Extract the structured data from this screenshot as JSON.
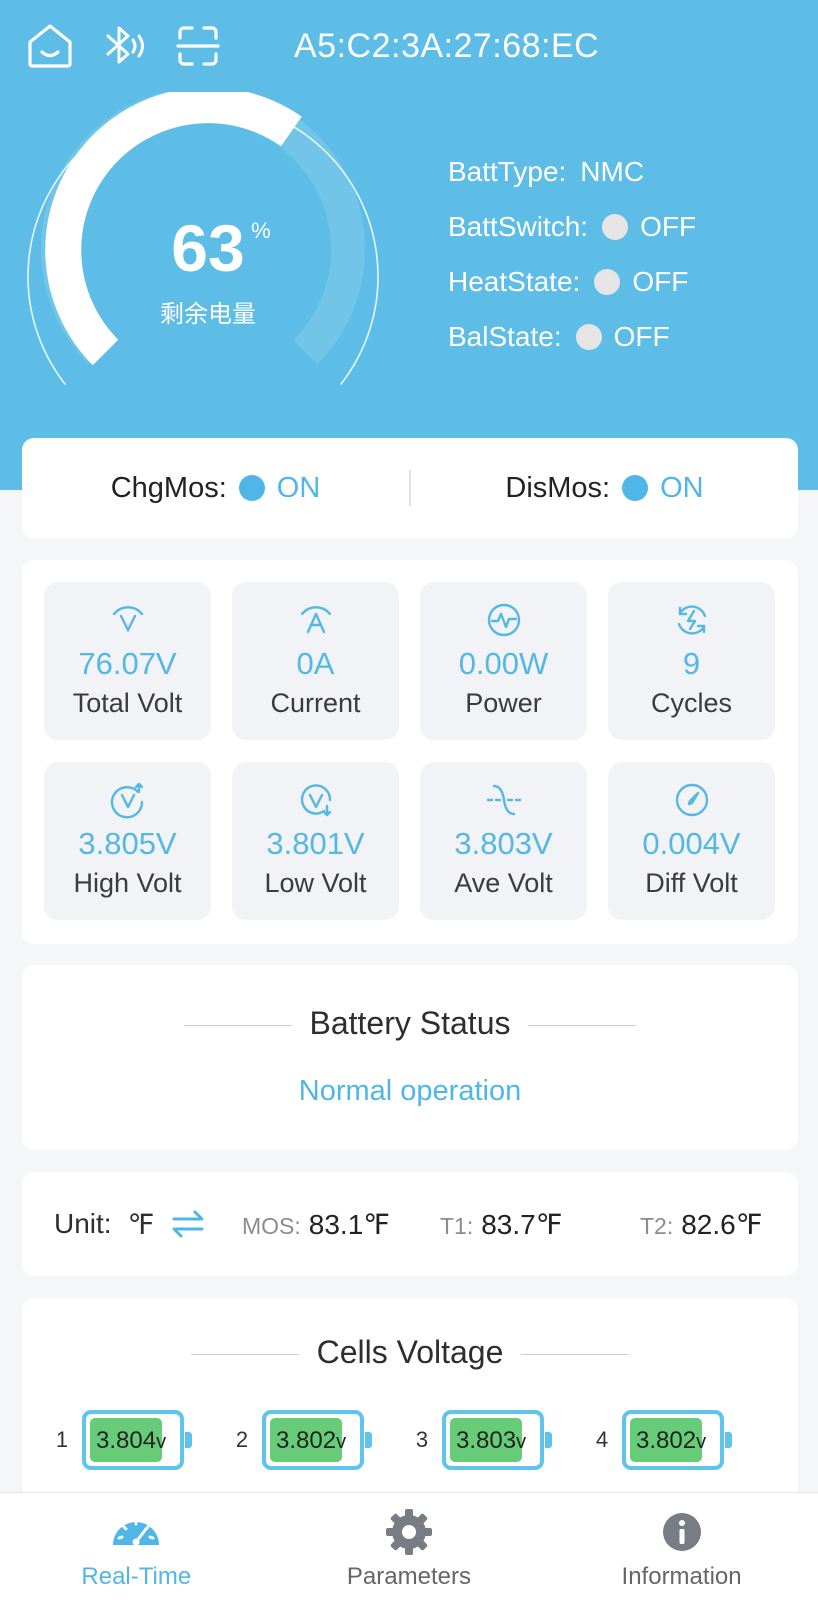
{
  "header": {
    "icons": [
      "home-icon",
      "bluetooth-icon",
      "scan-icon"
    ],
    "device_mac": "A5:C2:3A:27:68:EC"
  },
  "gauge": {
    "soc_value": "63",
    "soc_unit": "%",
    "soc_fraction": 0.63,
    "label": "剩余电量"
  },
  "status": {
    "batt_type_key": "BattType:",
    "batt_type_val": "NMC",
    "batt_switch_key": "BattSwitch:",
    "batt_switch_val": "OFF",
    "heat_state_key": "HeatState:",
    "heat_state_val": "OFF",
    "bal_state_key": "BalState:",
    "bal_state_val": "OFF"
  },
  "mos": {
    "chg_key": "ChgMos:",
    "chg_val": "ON",
    "dis_key": "DisMos:",
    "dis_val": "ON"
  },
  "metrics": [
    {
      "value": "76.07V",
      "label": "Total Volt",
      "icon": "voltage-icon"
    },
    {
      "value": "0A",
      "label": "Current",
      "icon": "current-icon"
    },
    {
      "value": "0.00W",
      "label": "Power",
      "icon": "power-icon"
    },
    {
      "value": "9",
      "label": "Cycles",
      "icon": "cycles-icon"
    },
    {
      "value": "3.805V",
      "label": "High Volt",
      "icon": "high-volt-icon"
    },
    {
      "value": "3.801V",
      "label": "Low Volt",
      "icon": "low-volt-icon"
    },
    {
      "value": "3.803V",
      "label": "Ave Volt",
      "icon": "ave-volt-icon"
    },
    {
      "value": "0.004V",
      "label": "Diff Volt",
      "icon": "diff-volt-icon"
    }
  ],
  "battery_status": {
    "title": "Battery Status",
    "value": "Normal operation"
  },
  "temperature": {
    "unit_key": "Unit:",
    "unit_val": "℉",
    "mos_key": "MOS:",
    "mos_val": "83.1℉",
    "t1_key": "T1:",
    "t1_val": "83.7℉",
    "t2_key": "T2:",
    "t2_val": "82.6℉"
  },
  "cells": {
    "title": "Cells Voltage",
    "unit": "v",
    "items": [
      {
        "index": "1",
        "value": "3.804"
      },
      {
        "index": "2",
        "value": "3.802"
      },
      {
        "index": "3",
        "value": "3.803"
      },
      {
        "index": "4",
        "value": "3.802"
      }
    ]
  },
  "nav": {
    "realtime_label": "Real-Time",
    "parameters_label": "Parameters",
    "information_label": "Information"
  },
  "colors": {
    "header_bg": "#5dbde6",
    "accent": "#4fb6e7",
    "cell_fill": "#66cc77"
  }
}
